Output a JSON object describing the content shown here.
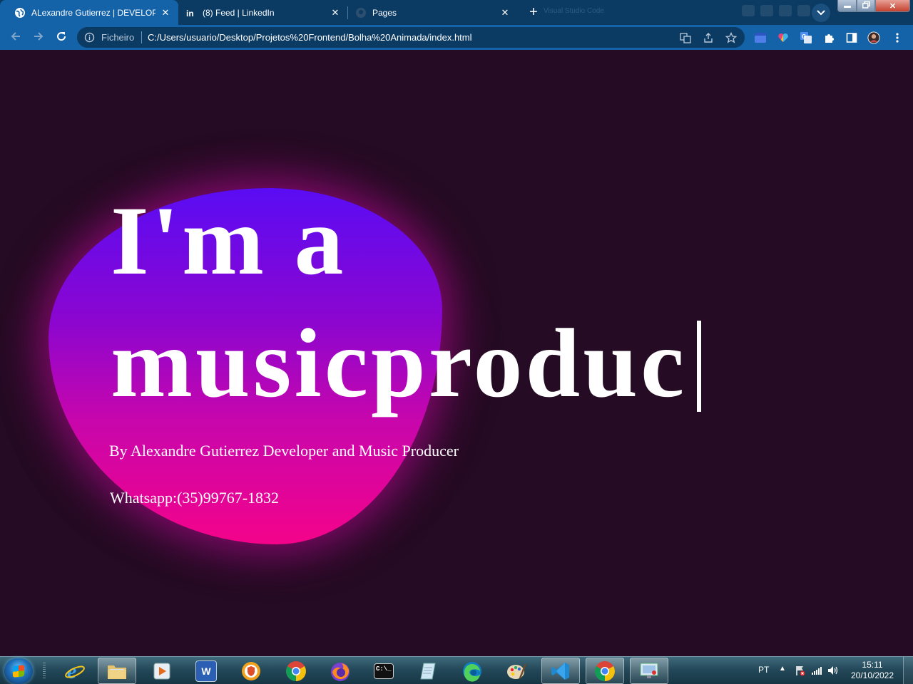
{
  "browser": {
    "tabs": [
      {
        "title": "ALexandre Gutierrez | DEVELOPER",
        "icon": "globe-icon",
        "active": true
      },
      {
        "title": "(8) Feed | LinkedIn",
        "icon": "linkedin-icon",
        "active": false
      },
      {
        "title": "Pages",
        "icon": "github-icon",
        "active": false
      }
    ],
    "new_tab": "+",
    "ghost_title": "Visual Studio Code",
    "omnibox": {
      "chip": "Ficheiro",
      "url": "C:/Users/usuario/Desktop/Projetos%20Frontend/Bolha%20Animada/index.html"
    },
    "colors": {
      "tabstrip": "#0b3a63",
      "toolbar": "#1462a8"
    }
  },
  "page": {
    "headline_line1": "I'm a",
    "headline_line2": "musicproduc",
    "byline": "By Alexandre Gutierrez Developer and Music Producer",
    "whatsapp": "Whatsapp:(35)99767-1832",
    "colors": {
      "background": "#250b23",
      "blob_top": "#5a0cf4",
      "blob_bottom": "#f4038a"
    }
  },
  "taskbar": {
    "pinned": [
      {
        "name": "internet-explorer",
        "icon": "ie-icon"
      },
      {
        "name": "file-explorer",
        "icon": "folder-icon"
      },
      {
        "name": "media-player",
        "icon": "media-icon"
      },
      {
        "name": "word",
        "icon": "word-icon",
        "label": "W"
      },
      {
        "name": "vpn",
        "icon": "shield-icon"
      },
      {
        "name": "chrome",
        "icon": "chrome-icon"
      },
      {
        "name": "firefox",
        "icon": "firefox-icon"
      },
      {
        "name": "terminal",
        "icon": "terminal-icon",
        "label": "C:\\_"
      },
      {
        "name": "notes",
        "icon": "notes-icon"
      },
      {
        "name": "edge",
        "icon": "edge-icon"
      },
      {
        "name": "paint",
        "icon": "paint-icon"
      },
      {
        "name": "vscode",
        "icon": "vscode-icon"
      },
      {
        "name": "chrome-open",
        "icon": "chrome-icon"
      },
      {
        "name": "remote-desktop",
        "icon": "monitor-icon"
      }
    ],
    "tray": {
      "language": "PT",
      "time": "15:11",
      "date": "20/10/2022"
    }
  }
}
